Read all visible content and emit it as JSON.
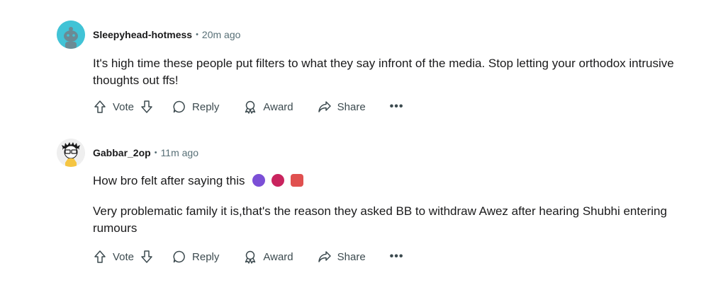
{
  "comments": [
    {
      "username": "Sleepyhead-hotmess",
      "separator": "•",
      "time": "20m ago",
      "paragraphs": [
        "It's high time these people put filters to what they say infront of the media. Stop letting your orthodox intrusive thoughts out ffs!"
      ],
      "actions": {
        "vote": "Vote",
        "reply": "Reply",
        "award": "Award",
        "share": "Share",
        "more": "•••"
      },
      "avatar_color": "#41c3d6"
    },
    {
      "username": "Gabbar_2op",
      "separator": "•",
      "time": "11m ago",
      "paragraphs": [
        "How bro felt after saying this",
        "Very problematic family it is,that's the reason they asked BB to withdraw Awez after hearing Shubhi entering rumours"
      ],
      "emojis": [
        "purple-devil-emoji",
        "devil-face-emoji",
        "red-devil-emoji"
      ],
      "actions": {
        "vote": "Vote",
        "reply": "Reply",
        "award": "Award",
        "share": "Share",
        "more": "•••"
      }
    }
  ]
}
